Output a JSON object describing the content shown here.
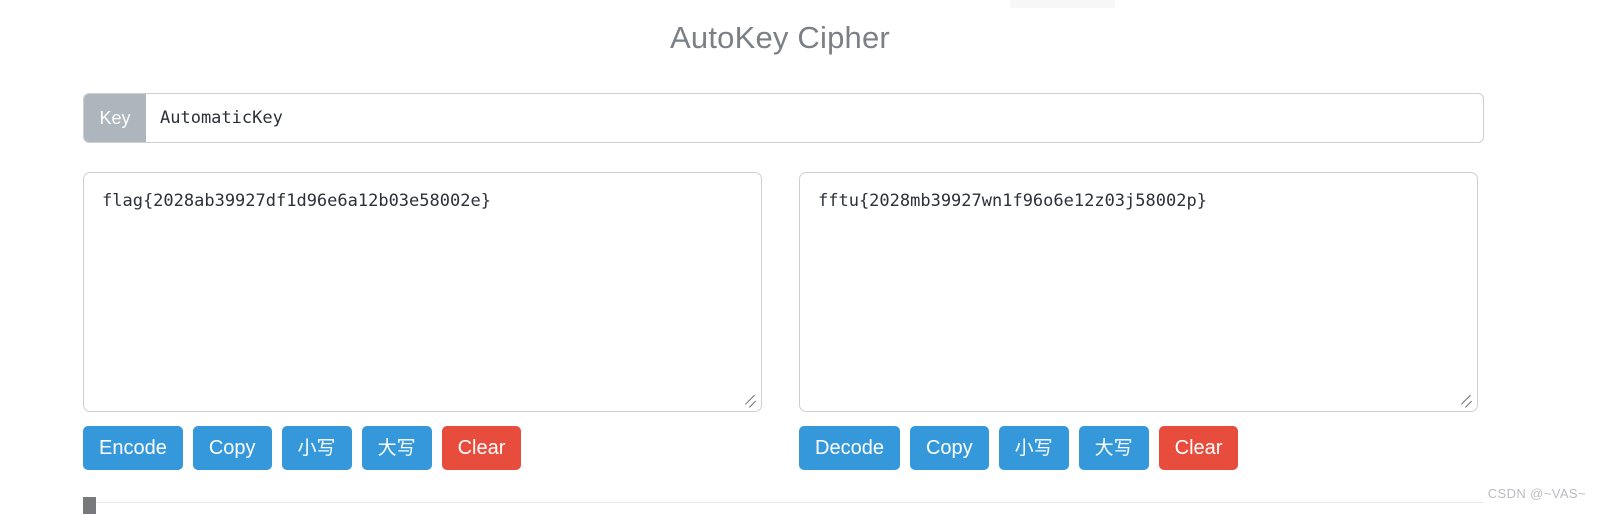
{
  "page": {
    "title": "AutoKey Cipher",
    "watermark": "CSDN @~VAS~"
  },
  "colors": {
    "title": "#7b8086",
    "primary_button": "#3498db",
    "danger_button": "#e74c3c",
    "addon_background": "#adb5bd",
    "border": "#ccd0d4"
  },
  "key_field": {
    "label": "Key",
    "value": "AutomaticKey",
    "placeholder": "Key"
  },
  "panels": [
    {
      "id": "plaintext",
      "textarea": {
        "value": "flag{2028ab39927df1d96e6a12b03e58002e}",
        "placeholder": ""
      },
      "buttons": [
        {
          "label": "Encode",
          "style": "blue",
          "name": "encode-button"
        },
        {
          "label": "Copy",
          "style": "blue",
          "name": "copy-button"
        },
        {
          "label": "小写",
          "style": "blue",
          "name": "lowercase-button"
        },
        {
          "label": "大写",
          "style": "blue",
          "name": "uppercase-button"
        },
        {
          "label": "Clear",
          "style": "red",
          "name": "clear-button"
        }
      ]
    },
    {
      "id": "ciphertext",
      "textarea": {
        "value": "fftu{2028mb39927wn1f96o6e12z03j58002p}",
        "placeholder": ""
      },
      "buttons": [
        {
          "label": "Decode",
          "style": "blue",
          "name": "decode-button"
        },
        {
          "label": "Copy",
          "style": "blue",
          "name": "copy-button"
        },
        {
          "label": "小写",
          "style": "blue",
          "name": "lowercase-button"
        },
        {
          "label": "大写",
          "style": "blue",
          "name": "uppercase-button"
        },
        {
          "label": "Clear",
          "style": "red",
          "name": "clear-button"
        }
      ]
    }
  ]
}
